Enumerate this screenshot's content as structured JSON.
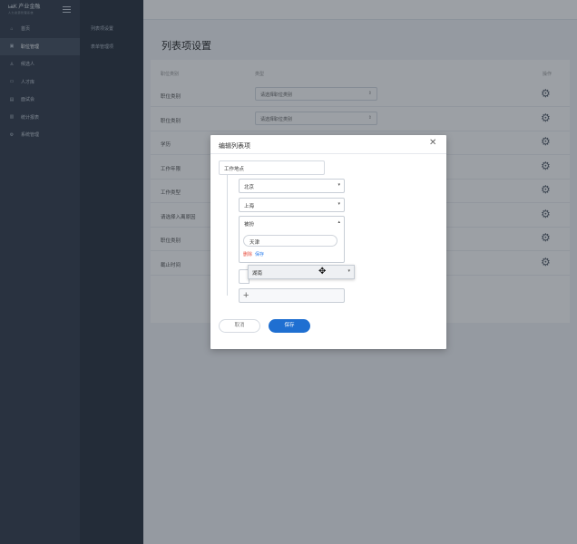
{
  "brand": {
    "name": "&lt;brand logo&gt;",
    "tagline": "人力资源管理系统"
  },
  "sidebar": {
    "items": [
      {
        "label": "首页",
        "icon": "home-icon"
      },
      {
        "label": "职位管理",
        "icon": "briefcase-icon",
        "active": true
      },
      {
        "label": "候选人",
        "icon": "person-icon"
      },
      {
        "label": "人才库",
        "icon": "folder-icon"
      },
      {
        "label": "面试会",
        "icon": "calendar-icon"
      },
      {
        "label": "统计报表",
        "icon": "chart-icon"
      },
      {
        "label": "系统管理",
        "icon": "gear-icon"
      }
    ]
  },
  "subnav": {
    "items": [
      "列表项设置",
      "表单管理项"
    ]
  },
  "page": {
    "title": "列表项设置",
    "columns": {
      "name": "职位类别",
      "content": "类型",
      "action": "操作"
    },
    "rows": [
      {
        "label": "职位类别",
        "select": "请选择职位类别"
      },
      {
        "label": "职位类别",
        "select": "请选择职位类别"
      },
      {
        "label": "学历",
        "select": ""
      },
      {
        "label": "工作年限",
        "select": ""
      },
      {
        "label": "工作类型",
        "select": ""
      },
      {
        "label": "请选择入离原因",
        "select": ""
      },
      {
        "label": "职位类别",
        "select": ""
      },
      {
        "label": "截止时间",
        "select": ""
      }
    ]
  },
  "modal": {
    "title": "编辑列表项",
    "field_value": "工作地点",
    "options": [
      "北京",
      "上海"
    ],
    "expanded_option": {
      "label": "被扮",
      "input_value": "天津",
      "delete_label": "删除",
      "save_label": "保存"
    },
    "dragging_option": "湖南",
    "cancel_label": "取消",
    "save_label": "保存"
  },
  "colors": {
    "primary": "#1f6fd1",
    "sidebar": "#394351",
    "danger": "#e74c3c"
  }
}
